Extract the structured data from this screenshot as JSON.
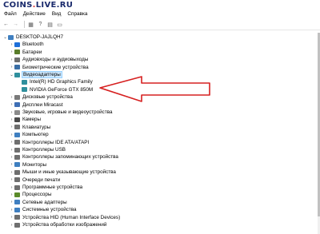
{
  "watermark": {
    "main": "COINS",
    "dot": ".",
    "tld": "LIVE.RU"
  },
  "menu": [
    "Файл",
    "Действие",
    "Вид",
    "Справка"
  ],
  "toolbar": {
    "buttons": [
      {
        "name": "back-icon",
        "glyph": "←",
        "disabled": false
      },
      {
        "name": "forward-icon",
        "glyph": "→",
        "disabled": true
      },
      {
        "name": "properties-icon",
        "glyph": "▦",
        "disabled": false
      },
      {
        "name": "help-icon",
        "glyph": "?",
        "disabled": false
      },
      {
        "name": "update-icon",
        "glyph": "▤",
        "disabled": false
      },
      {
        "name": "monitor-icon",
        "glyph": "▭",
        "disabled": false
      }
    ]
  },
  "tree": {
    "root": "DESKTOP-JAJLQH7",
    "items": [
      {
        "label": "Bluetooth",
        "icon": "bluetooth-icon",
        "color": "#1e6fd9",
        "expanded": false
      },
      {
        "label": "Батареи",
        "icon": "battery-icon",
        "color": "#5a7d2a",
        "expanded": false
      },
      {
        "label": "Аудиовходы и аудиовыходы",
        "icon": "audio-icon",
        "color": "#6f6f6f",
        "expanded": false
      },
      {
        "label": "Биометрические устройства",
        "icon": "biometric-icon",
        "color": "#3a6ea5",
        "expanded": false
      },
      {
        "label": "Видеоадаптеры",
        "icon": "display-adapter-icon",
        "color": "#2f8f9d",
        "expanded": true,
        "selected": true
      },
      {
        "label": "Intel(R) HD Graphics Family",
        "icon": "gpu-icon",
        "color": "#2f8f9d",
        "child": true
      },
      {
        "label": "NVIDIA GeForce GTX 850M",
        "icon": "gpu-icon",
        "color": "#2f8f9d",
        "child": true
      },
      {
        "label": "Дисковые устройства",
        "icon": "disk-icon",
        "color": "#7a7a7a",
        "expanded": false
      },
      {
        "label": "Дисплеи Miracast",
        "icon": "miracast-icon",
        "color": "#3f6fb5",
        "expanded": false
      },
      {
        "label": "Звуковые, игровые и видеоустройства",
        "icon": "sound-icon",
        "color": "#8a8a8a",
        "expanded": false
      },
      {
        "label": "Камеры",
        "icon": "camera-icon",
        "color": "#4a4a4a",
        "expanded": false
      },
      {
        "label": "Клавиатуры",
        "icon": "keyboard-icon",
        "color": "#6f6f6f",
        "expanded": false
      },
      {
        "label": "Компьютер",
        "icon": "computer-icon",
        "color": "#3f7fc0",
        "expanded": false
      },
      {
        "label": "Контроллеры IDE ATA/ATAPI",
        "icon": "ide-icon",
        "color": "#6f6f6f",
        "expanded": false
      },
      {
        "label": "Контроллеры USB",
        "icon": "usb-icon",
        "color": "#6f6f6f",
        "expanded": false
      },
      {
        "label": "Контроллеры запоминающих устройства",
        "icon": "storage-icon",
        "color": "#6f6f6f",
        "expanded": false
      },
      {
        "label": "Мониторы",
        "icon": "monitor-icon",
        "color": "#3f7fc0",
        "expanded": false
      },
      {
        "label": "Мыши и иные указывающие устройства",
        "icon": "mouse-icon",
        "color": "#6f6f6f",
        "expanded": false
      },
      {
        "label": "Очереди печати",
        "icon": "print-queue-icon",
        "color": "#6f6f6f",
        "expanded": false
      },
      {
        "label": "Программные устройства",
        "icon": "software-icon",
        "color": "#6f6f6f",
        "expanded": false
      },
      {
        "label": "Процессоры",
        "icon": "processor-icon",
        "color": "#5a8a2a",
        "expanded": false
      },
      {
        "label": "Сетевые адаптеры",
        "icon": "network-icon",
        "color": "#3f7fc0",
        "expanded": false
      },
      {
        "label": "Системные устройства",
        "icon": "system-icon",
        "color": "#3f7fc0",
        "expanded": false
      },
      {
        "label": "Устройства HID (Human Interface Devices)",
        "icon": "hid-icon",
        "color": "#6f6f6f",
        "expanded": false
      },
      {
        "label": "Устройства обработки изображений",
        "icon": "imaging-icon",
        "color": "#6f6f6f",
        "expanded": false
      }
    ]
  },
  "colors": {
    "arrow": "#d62020",
    "selection": "#cce8ff"
  }
}
